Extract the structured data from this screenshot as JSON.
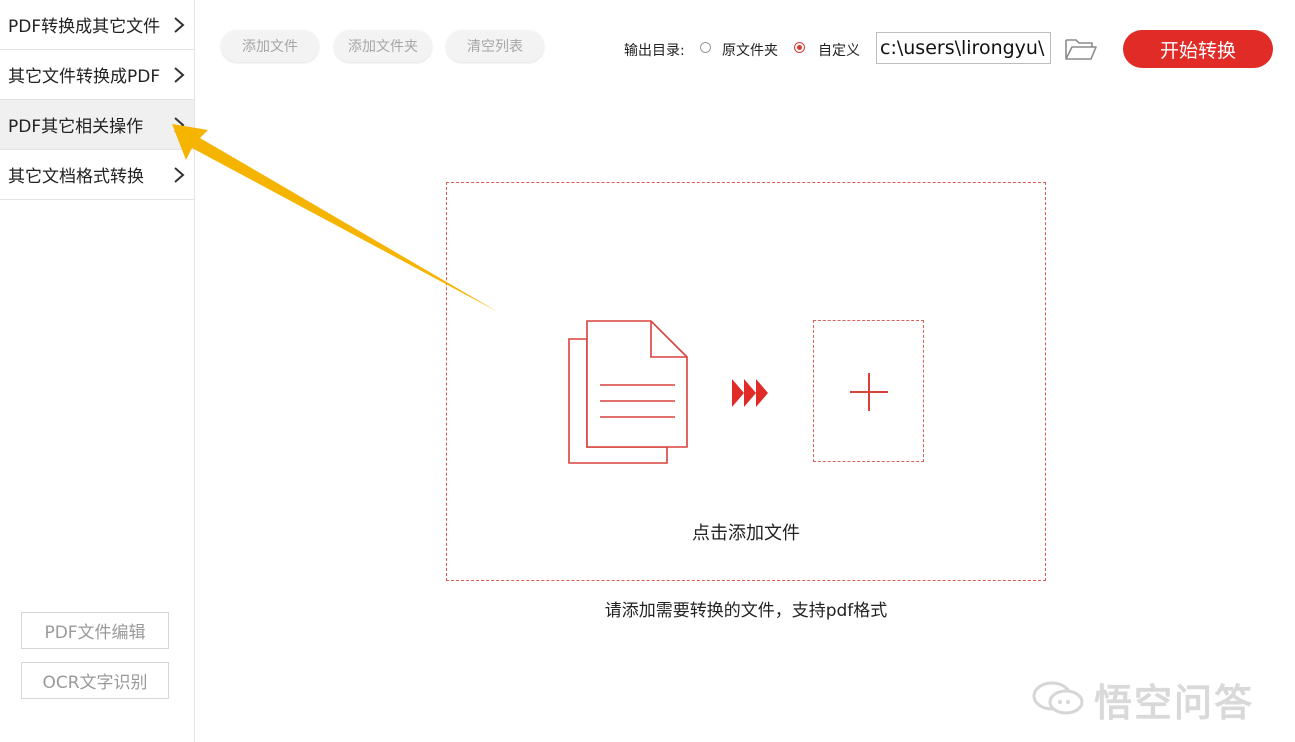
{
  "sidebar": {
    "items": [
      {
        "label": "PDF转换成其它文件"
      },
      {
        "label": "其它文件转换成PDF"
      },
      {
        "label": "PDF其它相关操作"
      },
      {
        "label": "其它文档格式转换"
      }
    ],
    "buttons": {
      "pdf_edit": "PDF文件编辑",
      "ocr": "OCR文字识别"
    }
  },
  "toolbar": {
    "add_file": "添加文件",
    "add_folder": "添加文件夹",
    "clear_list": "清空列表",
    "output_label": "输出目录:",
    "option_original": "原文件夹",
    "option_custom": "自定义",
    "selected_option": "自定义",
    "path_value": "c:\\users\\lirongyu\\",
    "start_label": "开始转换"
  },
  "dropzone": {
    "click_text": "点击添加文件",
    "hint": "请添加需要转换的文件，支持pdf格式"
  },
  "watermark": {
    "text": "悟空问答"
  },
  "colors": {
    "accent": "#e02b27",
    "arrow": "#f5b400",
    "dash": "#e05a55"
  }
}
